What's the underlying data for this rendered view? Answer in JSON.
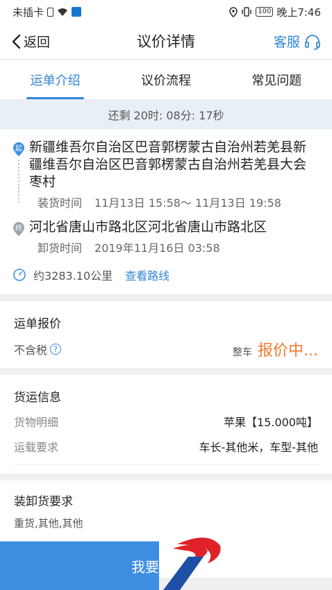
{
  "statusbar": {
    "carrier": "未插卡",
    "battery": "100",
    "time": "晚上7:46"
  },
  "nav": {
    "back_label": "返回",
    "title": "议价详情",
    "service_label": "客服"
  },
  "tabs": [
    {
      "label": "运单介绍"
    },
    {
      "label": "议价流程"
    },
    {
      "label": "常见问题"
    }
  ],
  "countdown": "还剩 20时: 08分: 17秒",
  "route": {
    "origin": {
      "badge": "起",
      "address": "新疆维吾尔自治区巴音郭楞蒙古自治州若羌县新疆维吾尔自治区巴音郭楞蒙古自治州若羌县大会枣村",
      "time_label": "装货时间",
      "time_value": "11月13日 15:58～ 11月13日 19:58"
    },
    "destination": {
      "badge": "终",
      "address": "河北省唐山市路北区河北省唐山市路北区",
      "time_label": "卸货时间",
      "time_value": "2019年11月16日 03:58"
    },
    "distance": "约3283.10公里",
    "view_route": "查看路线"
  },
  "quote": {
    "title": "运单报价",
    "tax_label": "不含税",
    "help_icon": "?",
    "type": "整车",
    "status": "报价中..."
  },
  "cargo": {
    "title": "货运信息",
    "rows": [
      {
        "key": "货物明细",
        "value": "苹果【15.000吨】"
      },
      {
        "key": "运载要求",
        "value": "车长-其他米，车型-其他"
      }
    ]
  },
  "loading": {
    "title": "装卸货要求",
    "value": "重货,其他,其他"
  },
  "bottom": {
    "button_label": "我要"
  },
  "colors": {
    "accent": "#2f86d6",
    "orange": "#f07a2a",
    "button": "#3d8ee1",
    "logo_red": "#e0232a",
    "logo_blue": "#1d4fa6"
  }
}
